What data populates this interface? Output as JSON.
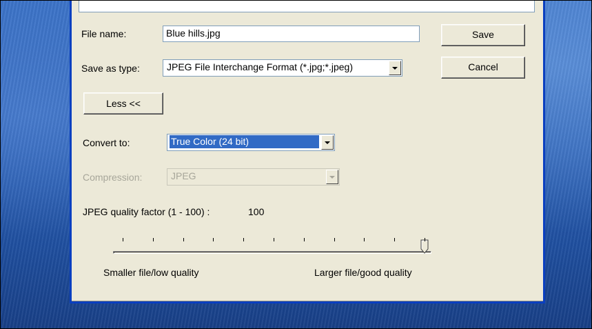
{
  "dialog": {
    "file_name_label": "File name:",
    "file_name_value": "Blue hills.jpg",
    "save_as_type_label": "Save as type:",
    "save_as_type_value": "JPEG File Interchange Format (*.jpg;*.jpeg)",
    "save_button": "Save",
    "cancel_button": "Cancel",
    "less_button": "Less <<"
  },
  "options": {
    "convert_to_label": "Convert to:",
    "convert_to_value": "True Color (24 bit)",
    "compression_label": "Compression:",
    "compression_value": "JPEG",
    "compression_enabled": false,
    "quality_label": "JPEG quality factor (1 - 100) :",
    "quality_value": "100",
    "slider_min_label": "Smaller file/low quality",
    "slider_max_label": "Larger file/good quality",
    "slider_fraction": 1.0,
    "tick_count": 11
  },
  "colors": {
    "dialog_bg": "#ece9d8",
    "selection": "#316ac5",
    "xp_frame": "#0a3fc0"
  }
}
